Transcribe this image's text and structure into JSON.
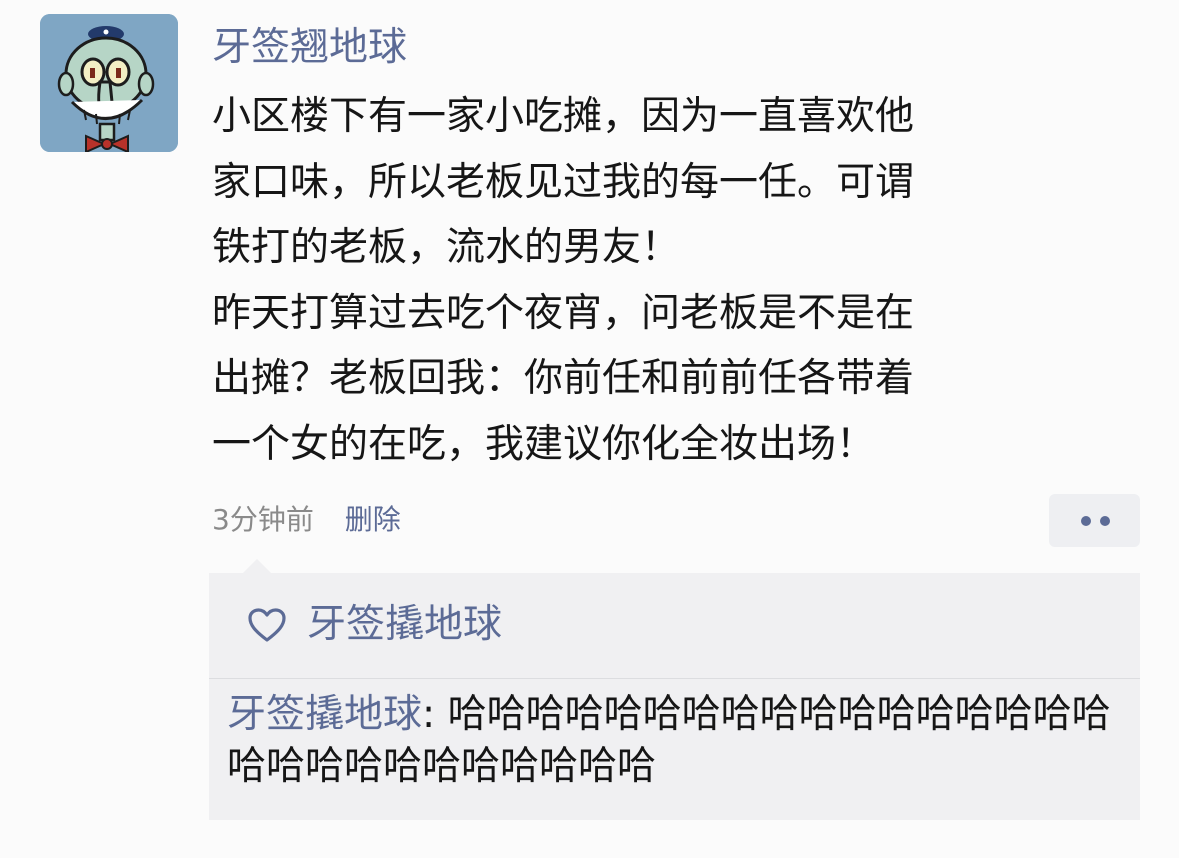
{
  "post": {
    "username": "牙签翘地球",
    "content_lines": [
      "小区楼下有一家小吃摊，因为一直喜欢他",
      "家口味，所以老板见过我的每一任。可谓",
      "铁打的老板，流水的男友！",
      "昨天打算过去吃个夜宵，问老板是不是在",
      "出摊？老板回我：你前任和前前任各带着",
      "一个女的在吃，我建议你化全妆出场！"
    ],
    "timestamp": "3分钟前",
    "delete_label": "删除",
    "more_icon": "more-dots-icon"
  },
  "interaction": {
    "like_icon": "heart-outline-icon",
    "likers": "牙签撬地球",
    "comments": [
      {
        "author": "牙签撬地球",
        "separator": ": ",
        "text": "哈哈哈哈哈哈哈哈哈哈哈哈哈哈哈哈哈哈哈哈哈哈哈哈哈哈哈哈"
      }
    ]
  },
  "colors": {
    "link": "#5c6b96",
    "text": "#161616",
    "meta": "#8a8a8a",
    "panel": "#f0f0f2",
    "background": "#fbfbfb"
  }
}
